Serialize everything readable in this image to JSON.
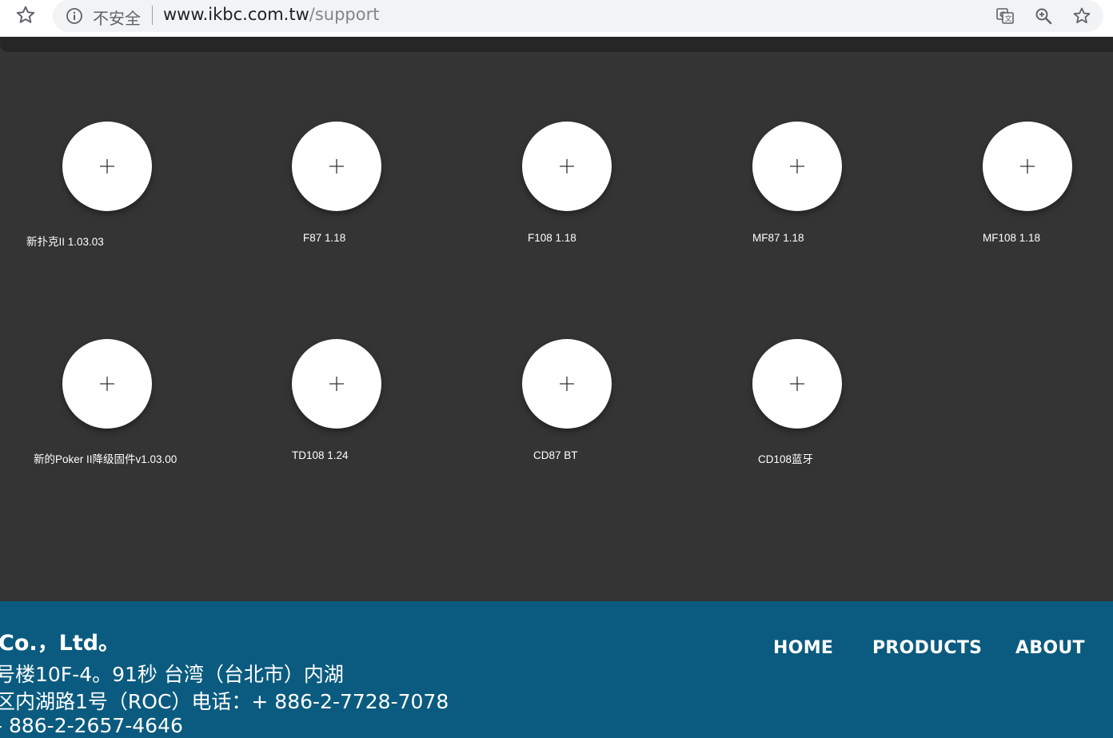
{
  "browser": {
    "security_label": "不安全",
    "url_host": "www.ikbc.com.tw",
    "url_path": "/support",
    "icons": [
      "bookmark-star-icon",
      "info-icon",
      "translate-icon",
      "zoom-icon",
      "star-icon"
    ]
  },
  "products": [
    {
      "label": "新扑克II 1.03.03"
    },
    {
      "label": "F87 1.18"
    },
    {
      "label": "F108 1.18"
    },
    {
      "label": "MF87 1.18"
    },
    {
      "label": "MF108 1.18"
    },
    {
      "label": "新的Poker II降级固件v1.03.00"
    },
    {
      "label": "TD108 1.24"
    },
    {
      "label": "CD87 BT"
    },
    {
      "label": "CD108蓝牙"
    }
  ],
  "footer": {
    "company": "Co.，Ltd。",
    "address_lines": [
      "号楼10F-4。91秒 台湾（台北市）内湖",
      "区内湖路1号（ROC）电话：+ 886-2-7728-7078",
      "- 886-2-2657-4646"
    ],
    "nav": {
      "home": "HOME",
      "products": "PRODUCTS",
      "about": "ABOUT"
    }
  },
  "colors": {
    "page_bg": "#343434",
    "footer_bg": "#0b5b80",
    "circle": "#ffffff"
  }
}
